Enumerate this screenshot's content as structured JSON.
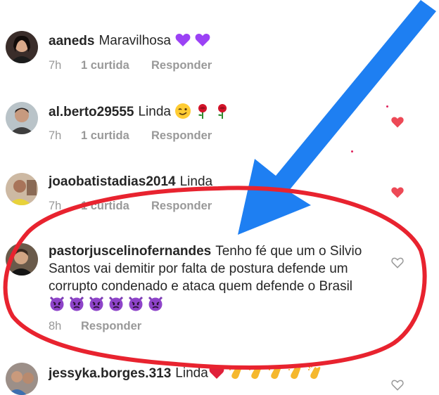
{
  "comments": [
    {
      "username": "aaneds",
      "text": "Maravilhosa",
      "emojis": [
        "purple-heart",
        "purple-heart"
      ],
      "time": "7h",
      "likes": "1 curtida",
      "reply": "Responder",
      "liked": true
    },
    {
      "username": "al.berto29555",
      "text": "Linda",
      "emojis": [
        "winking-face",
        "rose",
        "rose"
      ],
      "time": "7h",
      "likes": "1 curtida",
      "reply": "Responder",
      "liked": true
    },
    {
      "username": "joaobatistadias2014",
      "text": "Linda",
      "emojis": [],
      "time": "7h",
      "likes": "1 curtida",
      "reply": "Responder",
      "liked": true
    },
    {
      "username": "pastorjuscelinofernandes",
      "text": "Tenho fé que um o Silvio Santos vai demitir por falta de postura defende um corrupto condenado e ataca quem defende o Brasil",
      "emojis": [
        "angry-devil",
        "angry-devil",
        "angry-devil",
        "angry-devil",
        "angry-devil",
        "angry-devil"
      ],
      "time": "8h",
      "likes": "",
      "reply": "Responder",
      "liked": false
    },
    {
      "username": "jessyka.borges.313",
      "text": "Linda",
      "emojis": [
        "red-heart",
        "clapping-hands",
        "clapping-hands",
        "clapping-hands",
        "clapping-hands",
        "clapping-hands"
      ],
      "time": "",
      "likes": "",
      "reply": "",
      "liked": false
    }
  ],
  "colors": {
    "liked_heart": "#ed4956",
    "annotation_red": "#e8232f",
    "annotation_blue": "#1e7ff2",
    "meta_gray": "#999999"
  }
}
